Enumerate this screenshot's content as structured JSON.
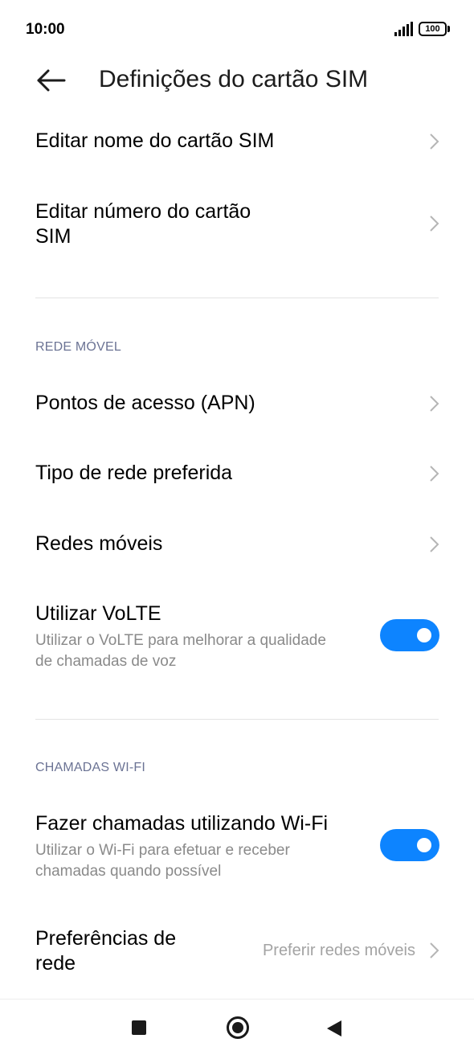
{
  "status_bar": {
    "time": "10:00",
    "battery": "100",
    "icons": [
      "signal-icon",
      "battery-icon"
    ]
  },
  "header": {
    "back_icon": "arrow-left-icon",
    "title": "Definições do cartão SIM"
  },
  "items": {
    "edit_name": {
      "title": "Editar nome do cartão SIM"
    },
    "edit_number": {
      "title_line1": "Editar número do cartão",
      "title_line2": "SIM"
    },
    "apn": {
      "title": "Pontos de acesso (APN)"
    },
    "preferred_network": {
      "title": "Tipo de rede preferida"
    },
    "mobile_networks": {
      "title": "Redes móveis"
    },
    "volte": {
      "title": "Utilizar VoLTE",
      "subtitle_line1": "Utilizar o VoLTE para melhorar a qualidade",
      "subtitle_line2": "de chamadas de voz",
      "enabled": true
    },
    "wifi_calling": {
      "title": "Fazer chamadas utilizando Wi-Fi",
      "subtitle_line1": "Utilizar o Wi-Fi para efetuar e receber",
      "subtitle_line2": "chamadas quando possível",
      "enabled": true
    },
    "network_preferences": {
      "title_line1": "Preferências de",
      "title_line2": "rede",
      "value": "Preferir redes móveis"
    }
  },
  "sections": {
    "mobile_network": "REDE MÓVEL",
    "wifi_calling": "CHAMADAS WI-FI"
  },
  "colors": {
    "accent": "#0d84ff",
    "section_label": "#6b7394",
    "secondary_text": "#8a8a8a"
  },
  "nav_bar": {
    "icons": [
      "recents-square-icon",
      "home-circle-icon",
      "back-triangle-icon"
    ]
  }
}
